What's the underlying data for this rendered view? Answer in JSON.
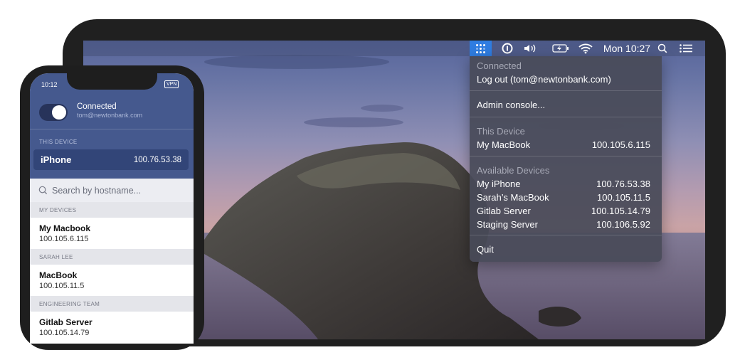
{
  "phone": {
    "status_time": "10:12",
    "vpn_badge": "VPN",
    "connection": {
      "status": "Connected",
      "account": "tom@newtonbank.com",
      "toggle_on": true
    },
    "this_device_header": "THIS DEVICE",
    "this_device": {
      "name": "iPhone",
      "ip": "100.76.53.38"
    },
    "search_placeholder": "Search by hostname...",
    "sections": [
      {
        "header": "MY DEVICES",
        "name": "My Macbook",
        "ip": "100.105.6.115"
      },
      {
        "header": "SARAH LEE",
        "name": "MacBook",
        "ip": "100.105.11.5"
      },
      {
        "header": "ENGINEERING TEAM",
        "name": "Gitlab Server",
        "ip": "100.105.14.79"
      }
    ]
  },
  "menubar": {
    "clock": "Mon 10:27",
    "icons": [
      "tailscale-icon",
      "onepassword-icon",
      "volume-icon",
      "battery-icon",
      "wifi-icon",
      "spotlight-icon",
      "notification-center-icon"
    ]
  },
  "menu": {
    "status_header": "Connected",
    "logout_label": "Log out (tom@newtonbank.com)",
    "admin_label": "Admin console...",
    "this_device_header": "This Device",
    "this_device": {
      "name": "My MacBook",
      "ip": "100.105.6.115"
    },
    "available_header": "Available Devices",
    "devices": [
      {
        "name": "My iPhone",
        "ip": "100.76.53.38"
      },
      {
        "name": "Sarah’s MacBook",
        "ip": "100.105.11.5"
      },
      {
        "name": "Gitlab Server",
        "ip": "100.105.14.79"
      },
      {
        "name": "Staging Server",
        "ip": "100.106.5.92"
      }
    ],
    "quit_label": "Quit"
  },
  "colors": {
    "accent": "#2f7de1",
    "phone_header": "#45598e",
    "selected_row": "#324578",
    "menu_bg": "#484a58"
  }
}
